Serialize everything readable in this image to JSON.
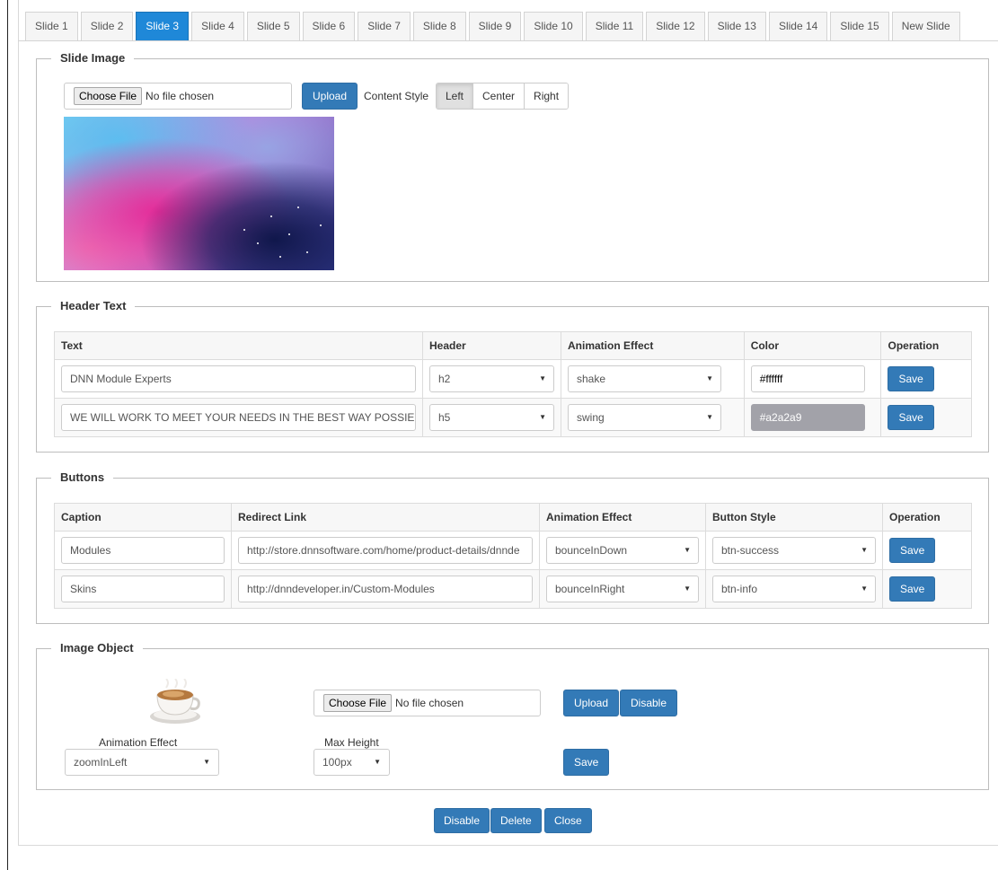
{
  "tabs": [
    {
      "label": "Slide 1"
    },
    {
      "label": "Slide 2"
    },
    {
      "label": "Slide 3"
    },
    {
      "label": "Slide 4"
    },
    {
      "label": "Slide 5"
    },
    {
      "label": "Slide 6"
    },
    {
      "label": "Slide 7"
    },
    {
      "label": "Slide 8"
    },
    {
      "label": "Slide 9"
    },
    {
      "label": "Slide 10"
    },
    {
      "label": "Slide 11"
    },
    {
      "label": "Slide 12"
    },
    {
      "label": "Slide 13"
    },
    {
      "label": "Slide 14"
    },
    {
      "label": "Slide 15"
    },
    {
      "label": "New Slide"
    }
  ],
  "active_tab": "Slide 3",
  "colors": {
    "primary": "#337ab7",
    "active_tab": "#1f88d8"
  },
  "slide_image": {
    "legend": "Slide Image",
    "choose_file": "Choose File",
    "no_file": "No file chosen",
    "upload": "Upload",
    "content_style_label": "Content Style",
    "content_style_options": [
      "Left",
      "Center",
      "Right"
    ],
    "content_style_selected": "Left"
  },
  "header_text": {
    "legend": "Header Text",
    "columns": [
      "Text",
      "Header",
      "Animation Effect",
      "Color",
      "Operation"
    ],
    "rows": [
      {
        "text": "DNN Module Experts",
        "header": "h2",
        "animation": "shake",
        "color": "#ffffff",
        "save": "Save"
      },
      {
        "text": "WE WILL WORK TO MEET YOUR NEEDS IN THE BEST WAY POSSIE",
        "header": "h5",
        "animation": "swing",
        "color": "#a2a2a9",
        "save": "Save"
      }
    ]
  },
  "buttons": {
    "legend": "Buttons",
    "columns": [
      "Caption",
      "Redirect Link",
      "Animation Effect",
      "Button Style",
      "Operation"
    ],
    "rows": [
      {
        "caption": "Modules",
        "link": "http://store.dnnsoftware.com/home/product-details/dnnde",
        "animation": "bounceInDown",
        "style": "btn-success",
        "save": "Save"
      },
      {
        "caption": "Skins",
        "link": "http://dnndeveloper.in/Custom-Modules",
        "animation": "bounceInRight",
        "style": "btn-info",
        "save": "Save"
      }
    ]
  },
  "image_object": {
    "legend": "Image Object",
    "choose_file": "Choose File",
    "no_file": "No file chosen",
    "upload": "Upload",
    "disable": "Disable",
    "animation_label": "Animation Effect",
    "animation_value": "zoomInLeft",
    "max_height_label": "Max Height",
    "max_height_value": "100px",
    "save": "Save"
  },
  "footer": {
    "disable": "Disable",
    "delete": "Delete",
    "close": "Close"
  }
}
